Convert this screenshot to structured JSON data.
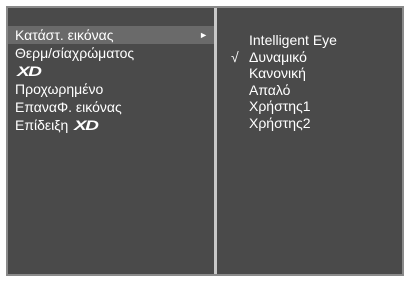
{
  "menu": {
    "items": [
      {
        "label": "Κατάστ. εικόνας",
        "selected": true,
        "has_submenu": true,
        "arrow": "►"
      },
      {
        "label": "Θερμ/σίαχρώματος",
        "selected": false
      },
      {
        "label": "",
        "logo": "XD",
        "selected": false
      },
      {
        "label": "Προχωρημένο",
        "selected": false
      },
      {
        "label": "ΕπαναΦ. εικόνας",
        "selected": false
      },
      {
        "label": "Επίδειξη",
        "logo": "XD",
        "selected": false
      }
    ]
  },
  "submenu": {
    "options": [
      {
        "label": "Intelligent Eye",
        "checked": false
      },
      {
        "label": "Δυναμικό",
        "checked": true
      },
      {
        "label": "Κανονική",
        "checked": false
      },
      {
        "label": "Απαλό",
        "checked": false
      },
      {
        "label": "Χρήστης1",
        "checked": false
      },
      {
        "label": "Χρήστης2",
        "checked": false
      }
    ],
    "check_glyph": "√"
  },
  "colors": {
    "panel_bg": "#4a4a4a",
    "highlight_bg": "#6a6a6a",
    "text": "#ffffff",
    "divider": "#c9c9c9"
  }
}
